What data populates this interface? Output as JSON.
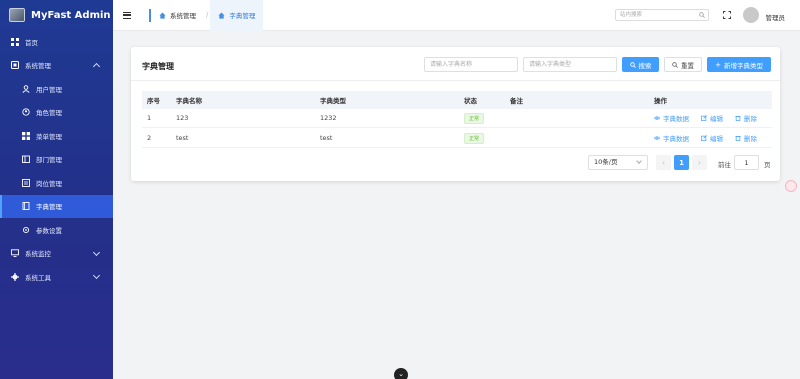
{
  "app": {
    "title": "MyFast Admin"
  },
  "sidebar": {
    "items": [
      {
        "label": "首页",
        "icon": "dashboard-icon"
      },
      {
        "label": "系统管理",
        "icon": "settings-icon",
        "expanded": true
      },
      {
        "label": "用户管理",
        "icon": "user-icon"
      },
      {
        "label": "角色管理",
        "icon": "role-icon"
      },
      {
        "label": "菜单管理",
        "icon": "menu-icon"
      },
      {
        "label": "部门管理",
        "icon": "department-icon"
      },
      {
        "label": "岗位管理",
        "icon": "post-icon"
      },
      {
        "label": "字典管理",
        "icon": "dictionary-icon",
        "active": true
      },
      {
        "label": "参数设置",
        "icon": "parameter-icon"
      },
      {
        "label": "系统监控",
        "icon": "monitor-icon",
        "expanded": false
      },
      {
        "label": "系统工具",
        "icon": "tools-icon",
        "expanded": false
      }
    ]
  },
  "header": {
    "breadcrumbs": [
      {
        "label": "系统管理"
      },
      {
        "label": "字典管理"
      }
    ],
    "search_placeholder": "站内搜索",
    "username": "管理员"
  },
  "main": {
    "card_title": "字典管理",
    "filters": {
      "name_placeholder": "请输入字典名称",
      "type_placeholder": "请输入字典类型"
    },
    "buttons": {
      "search": "搜索",
      "reset": "重置",
      "add": "新增字典类型"
    },
    "table": {
      "headers": [
        "序号",
        "字典名称",
        "字典类型",
        "状态",
        "备注",
        "操作"
      ],
      "rows": [
        {
          "index": "1",
          "name": "123",
          "type": "1232",
          "status": "正常",
          "remark": ""
        },
        {
          "index": "2",
          "name": "test",
          "type": "test",
          "status": "正常",
          "remark": ""
        }
      ],
      "actions": {
        "data": "字典数据",
        "edit": "编辑",
        "delete": "删除"
      }
    },
    "pagination": {
      "page_size": "10条/页",
      "current_page": "1",
      "goto_label": "前往",
      "goto_value": "1",
      "page_unit": "页"
    }
  },
  "colors": {
    "primary": "#409eff",
    "sidebar": "#23308a",
    "status_ok": "#67c23a"
  }
}
